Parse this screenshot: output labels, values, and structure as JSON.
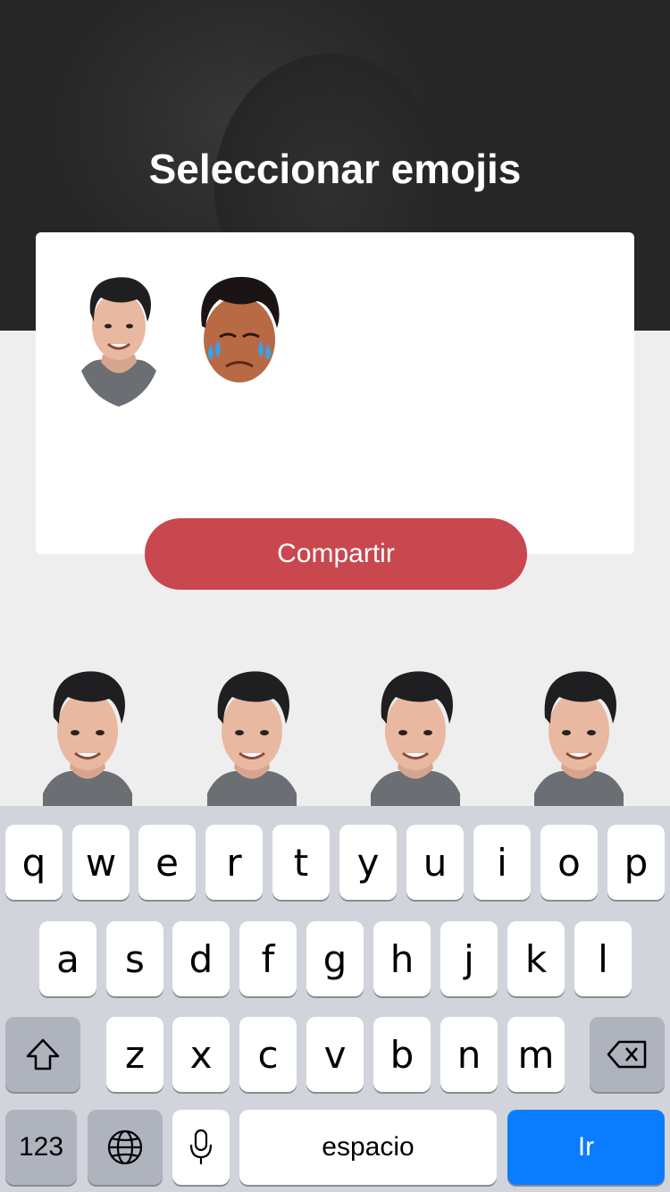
{
  "header": {
    "title": "Seleccionar emojis"
  },
  "selected_emojis": [
    {
      "name": "smiling-man-emoji"
    },
    {
      "name": "crying-man-emoji"
    }
  ],
  "share_button": {
    "label": "Compartir",
    "color": "#c9474e"
  },
  "emoji_row": [
    {
      "name": "smiling-man-emoji"
    },
    {
      "name": "smiling-man-emoji"
    },
    {
      "name": "smiling-man-emoji"
    },
    {
      "name": "smiling-man-emoji"
    }
  ],
  "keyboard": {
    "row1": [
      "q",
      "w",
      "e",
      "r",
      "t",
      "y",
      "u",
      "i",
      "o",
      "p"
    ],
    "row2": [
      "a",
      "s",
      "d",
      "f",
      "g",
      "h",
      "j",
      "k",
      "l"
    ],
    "row3": [
      "z",
      "x",
      "c",
      "v",
      "b",
      "n",
      "m"
    ],
    "numbers_label": "123",
    "space_label": "espacio",
    "go_label": "Ir",
    "go_color": "#0a7cff",
    "shift_icon": "shift-icon",
    "delete_icon": "backspace-icon",
    "globe_icon": "globe-icon",
    "mic_icon": "microphone-icon"
  }
}
